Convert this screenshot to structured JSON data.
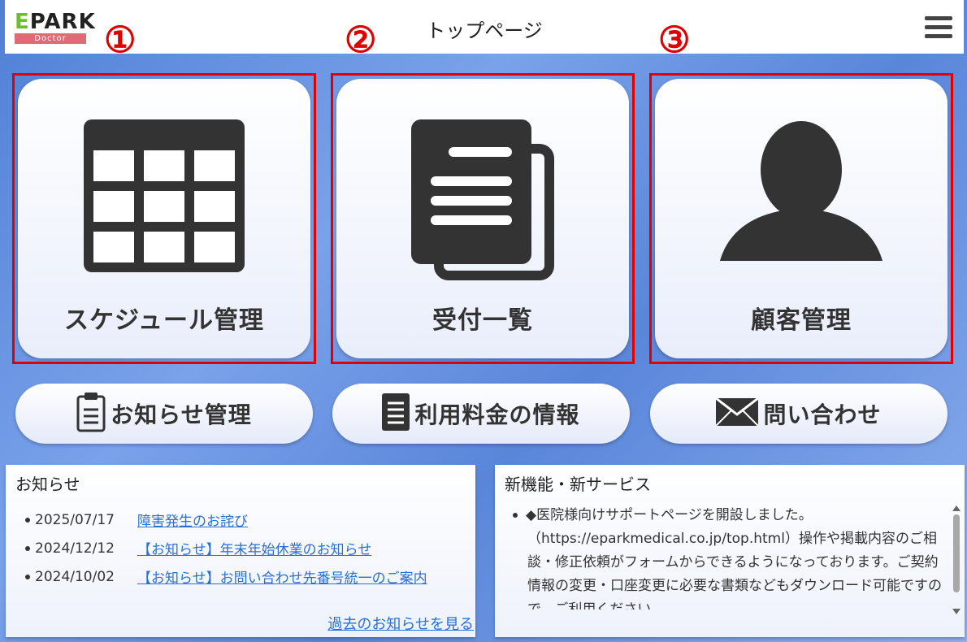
{
  "header": {
    "logo_brand_prefix": "E",
    "logo_brand_rest": "PARK",
    "logo_sub": "Doctor",
    "title": "トップページ",
    "menu_icon": "hamburger-menu-icon"
  },
  "callouts": [
    "①",
    "②",
    "③"
  ],
  "main_tiles": [
    {
      "label": "スケジュール管理",
      "icon": "calendar-grid-icon"
    },
    {
      "label": "受付一覧",
      "icon": "document-list-icon"
    },
    {
      "label": "顧客管理",
      "icon": "person-icon"
    }
  ],
  "sub_buttons": [
    {
      "label": "お知らせ管理",
      "icon": "clipboard-icon"
    },
    {
      "label": "利用料金の情報",
      "icon": "document-icon"
    },
    {
      "label": "問い合わせ",
      "icon": "envelope-icon"
    }
  ],
  "news": {
    "title": "お知らせ",
    "items": [
      {
        "date": "2025/07/17",
        "text": "障害発生のお詫び"
      },
      {
        "date": "2024/12/12",
        "text": "【お知らせ】年末年始休業のお知らせ"
      },
      {
        "date": "2024/10/02",
        "text": "【お知らせ】お問い合わせ先番号統一のご案内"
      }
    ],
    "more_link": "過去のお知らせを見る"
  },
  "services": {
    "title": "新機能・新サービス",
    "body": "◆医院様向けサポートページを開設しました。（https://eparkmedical.co.jp/top.html）操作や掲載内容のご相談・修正依頼がフォームからできるようになっております。ご契約情報の変更・口座変更に必要な書類などもダウンロード可能ですので、ご利用ください。"
  },
  "colors": {
    "callout_red": "#e00000",
    "link_blue": "#2a6fd6",
    "icon_dark": "#333333",
    "logo_green": "#6cbf2a",
    "logo_pink": "#e06b74"
  }
}
